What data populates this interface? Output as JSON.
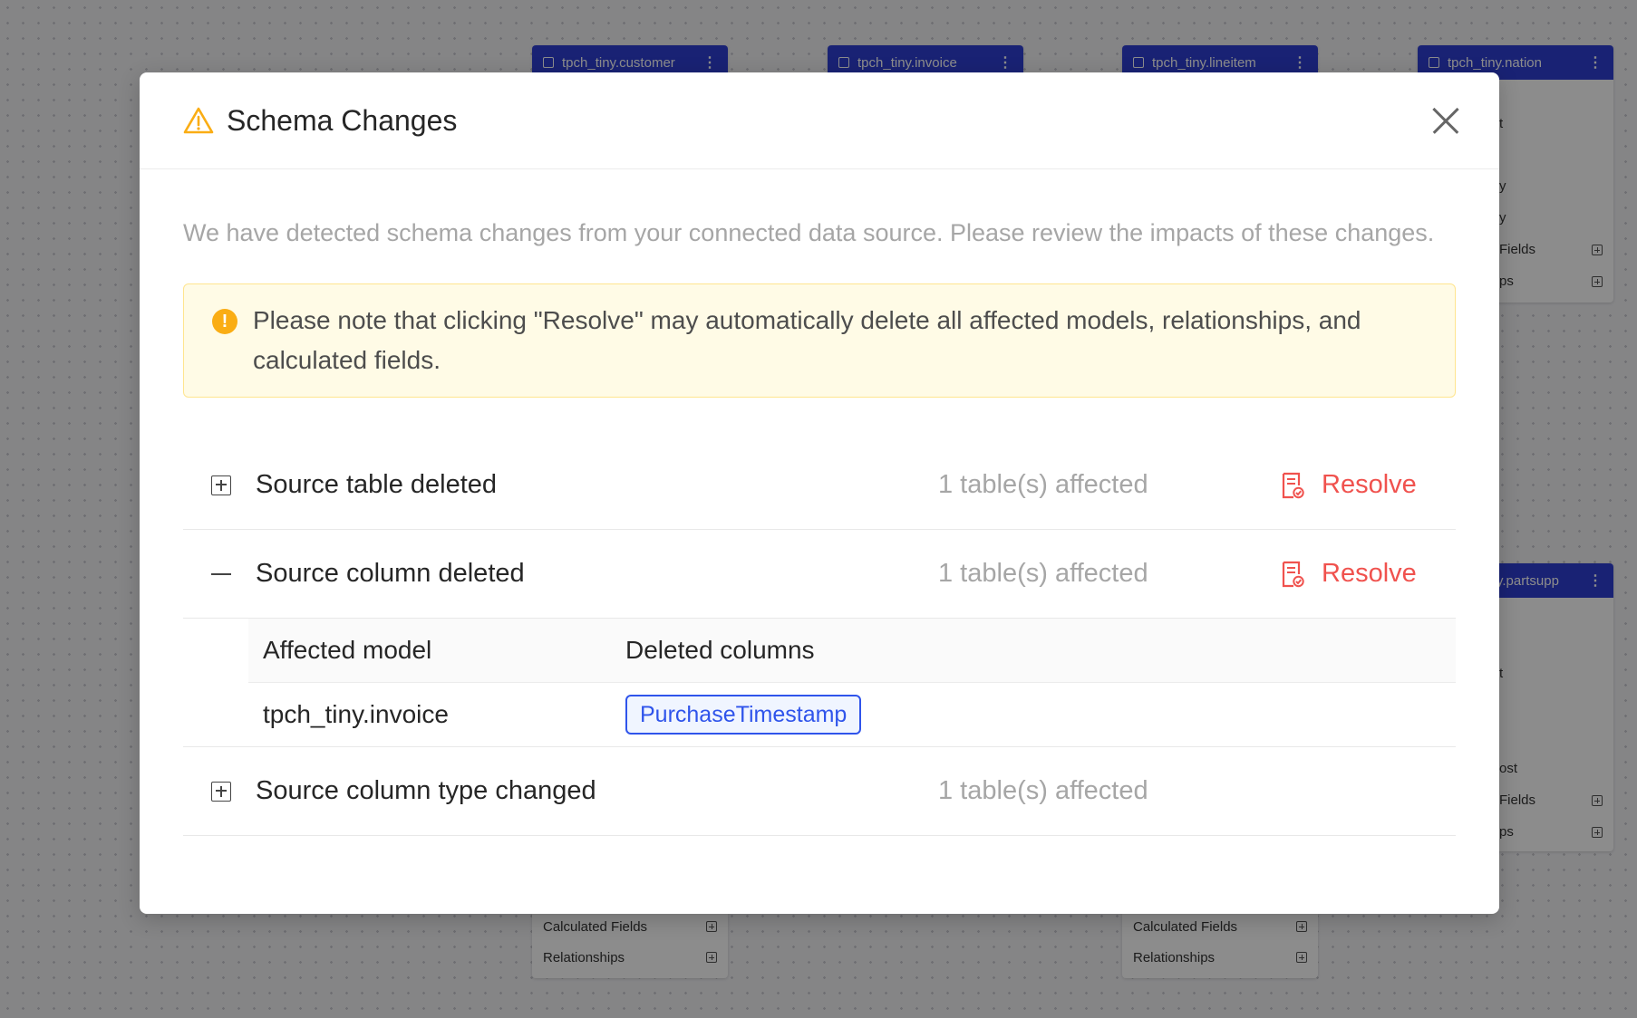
{
  "background": {
    "cards": [
      {
        "title": "tpch_tiny.customer",
        "rows": [],
        "left": 0
      },
      {
        "title": "tpch_tiny.invoice",
        "rows": []
      },
      {
        "title": "tpch_tiny.lineitem",
        "rows": []
      },
      {
        "title": "tpch_tiny.nation",
        "rows": [
          "t",
          "y",
          "y",
          "Fields",
          "ps"
        ]
      },
      {
        "title": "y.partsupp",
        "rows": [
          "t",
          "ost",
          "Fields",
          "ps"
        ]
      }
    ],
    "bottom_rows": {
      "calculated_fields": "Calculated Fields",
      "relationships": "Relationships"
    }
  },
  "modal": {
    "title": "Schema Changes",
    "description": "We have detected schema changes from your connected data source. Please review the impacts of these changes.",
    "alert": "Please note that clicking \"Resolve\" may automatically delete all affected models, relationships, and calculated fields.",
    "resolve_label": "Resolve",
    "panels": [
      {
        "title": "Source table deleted",
        "affected": "1 table(s) affected"
      },
      {
        "title": "Source column deleted",
        "affected": "1 table(s) affected"
      },
      {
        "title": "Source column type changed",
        "affected": "1 table(s) affected"
      }
    ],
    "table": {
      "headers": [
        "Affected model",
        "Deleted columns"
      ],
      "rows": [
        {
          "model": "tpch_tiny.invoice",
          "columns": [
            "PurchaseTimestamp"
          ]
        }
      ]
    }
  },
  "colors": {
    "card_header": "#2f3fd3",
    "resolve": "#f0524e",
    "warning": "#faad14",
    "tag": "#2f54eb"
  }
}
